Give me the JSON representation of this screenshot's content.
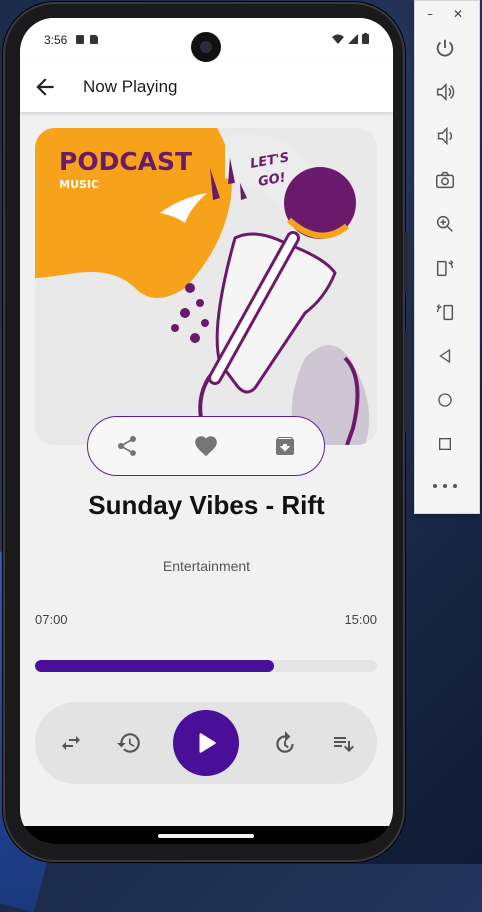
{
  "status_bar": {
    "time": "3:56"
  },
  "app_bar": {
    "title": "Now Playing",
    "back_icon": "arrow-back-icon"
  },
  "cover": {
    "brand_line1": "PODCAST",
    "brand_line2": "MUSIC",
    "tagline_line1": "LET'S",
    "tagline_line2": "GO!"
  },
  "actions": {
    "share_icon": "share-icon",
    "favorite_icon": "heart-icon",
    "download_icon": "archive-download-icon"
  },
  "track": {
    "title": "Sunday Vibes - Rift",
    "category": "Entertainment"
  },
  "playback": {
    "current_time": "07:00",
    "total_time": "15:00",
    "progress": 0.7
  },
  "controls": {
    "items": [
      "repeat-icon",
      "rewind-icon",
      "play-icon",
      "forward-icon",
      "playlist-icon"
    ]
  },
  "colors": {
    "accent": "#4a0f99",
    "cover_orange": "#f7a21b",
    "cover_purple": "#6b1a6b"
  },
  "emulator_panel": {
    "buttons": [
      "power-icon",
      "volume-up-icon",
      "volume-down-icon",
      "camera-icon",
      "zoom-icon",
      "rotate-left-icon",
      "rotate-right-icon",
      "back-icon",
      "home-icon",
      "overview-icon",
      "more-icon"
    ]
  }
}
